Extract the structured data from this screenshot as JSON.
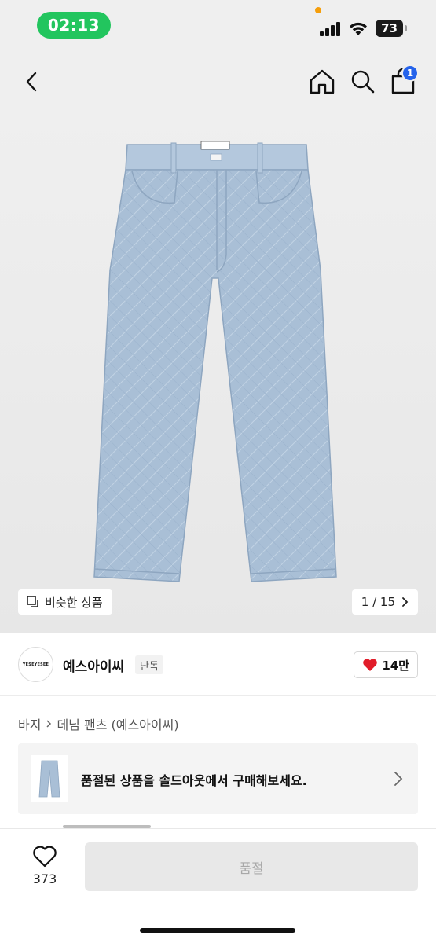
{
  "status_bar": {
    "time": "02:13",
    "battery": "73"
  },
  "nav": {
    "cart_count": "1"
  },
  "gallery": {
    "similar_label": "비슷한 상품",
    "counter": "1 / 15"
  },
  "brand": {
    "name": "예스아이씨",
    "tag": "단독",
    "like_count": "14만",
    "logo_text": "YESEYESEE"
  },
  "breadcrumb": {
    "level1": "바지",
    "level2": "데님 팬츠 (예스아이씨)"
  },
  "soldout_banner": {
    "text": "품절된 상품을 솔드아웃에서 구매해보세요."
  },
  "bottom_bar": {
    "wish_count": "373",
    "action_label": "품절"
  },
  "colors": {
    "time_pill": "#22c55e",
    "cart_badge": "#2563eb",
    "heart": "#e11d2a",
    "denim": "#a9bfd6"
  },
  "icons": [
    "back-arrow-icon",
    "home-icon",
    "search-icon",
    "shopping-bag-icon",
    "copy-icon",
    "chevron-right-icon",
    "heart-icon",
    "heart-outline-icon"
  ]
}
